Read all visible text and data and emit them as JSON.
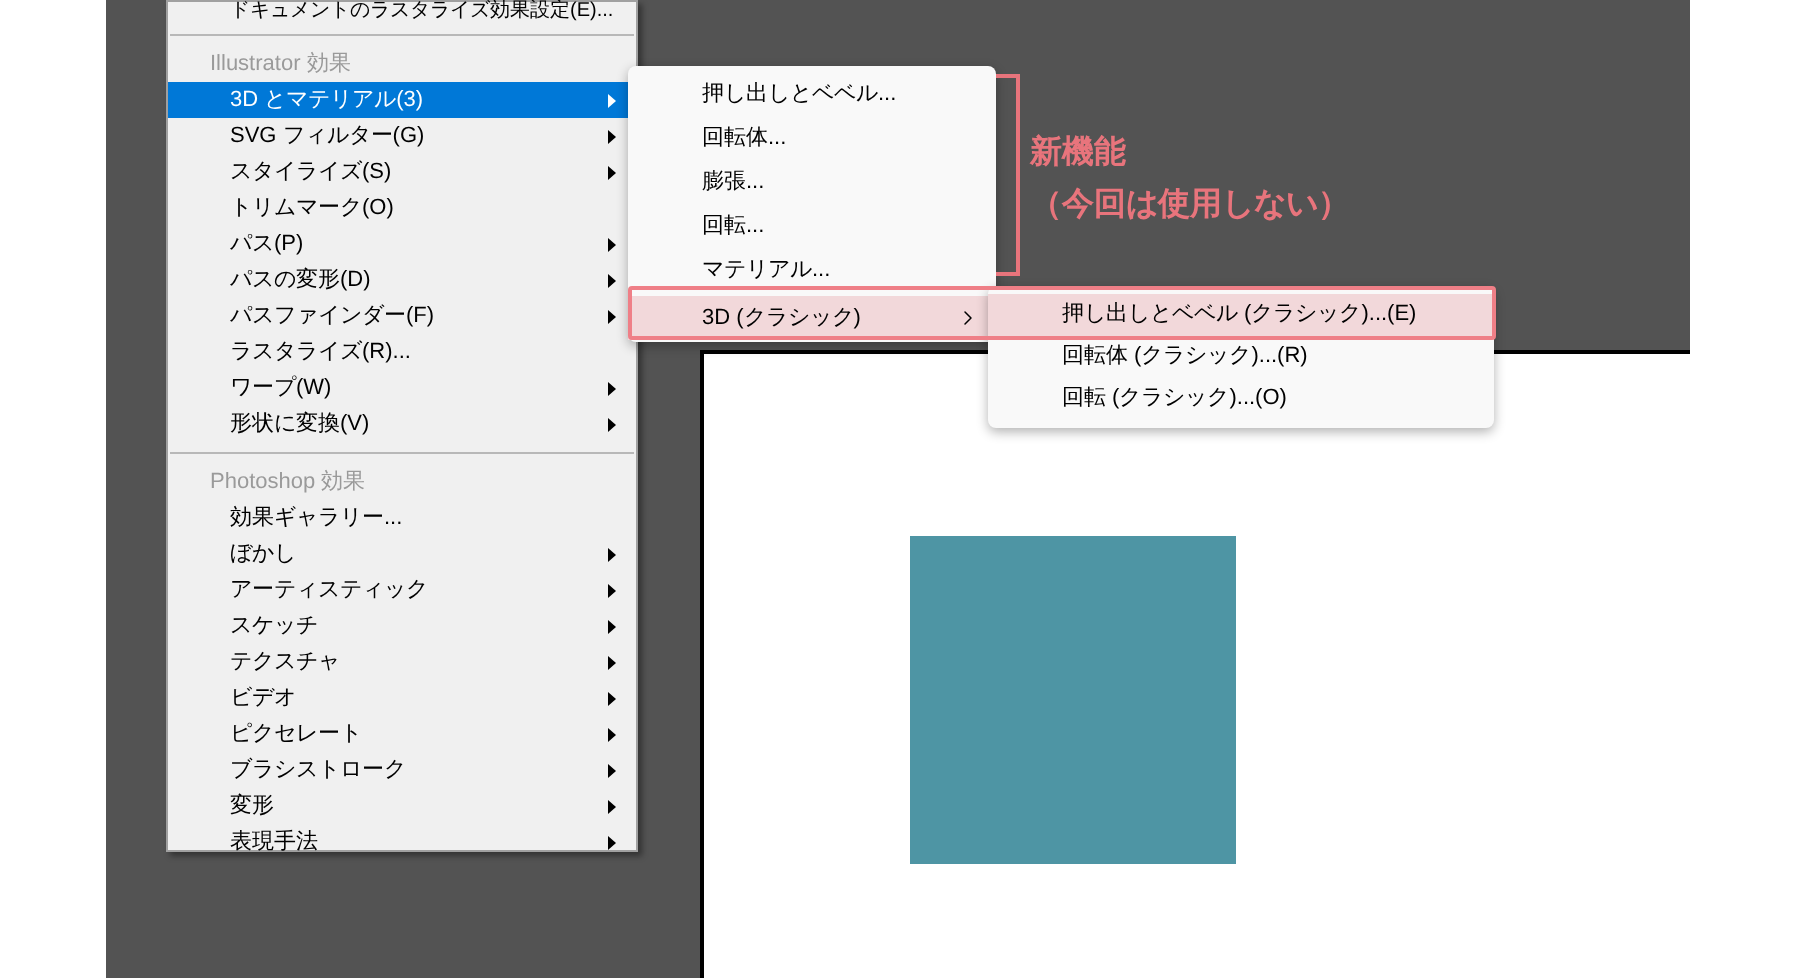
{
  "top_item": {
    "label": "ドキュメントのラスタライズ効果設定(E)..."
  },
  "illustrator_section": {
    "header": "Illustrator 効果",
    "items": [
      {
        "label": "3D とマテリアル(3)",
        "has_submenu": true,
        "selected": true
      },
      {
        "label": "SVG フィルター(G)",
        "has_submenu": true,
        "selected": false
      },
      {
        "label": "スタイライズ(S)",
        "has_submenu": true,
        "selected": false
      },
      {
        "label": "トリムマーク(O)",
        "has_submenu": false,
        "selected": false
      },
      {
        "label": "パス(P)",
        "has_submenu": true,
        "selected": false
      },
      {
        "label": "パスの変形(D)",
        "has_submenu": true,
        "selected": false
      },
      {
        "label": "パスファインダー(F)",
        "has_submenu": true,
        "selected": false
      },
      {
        "label": "ラスタライズ(R)...",
        "has_submenu": false,
        "selected": false
      },
      {
        "label": "ワープ(W)",
        "has_submenu": true,
        "selected": false
      },
      {
        "label": "形状に変換(V)",
        "has_submenu": true,
        "selected": false
      }
    ]
  },
  "photoshop_section": {
    "header": "Photoshop 効果",
    "items": [
      {
        "label": "効果ギャラリー...",
        "has_submenu": false,
        "selected": false
      },
      {
        "label": "ぼかし",
        "has_submenu": true,
        "selected": false
      },
      {
        "label": "アーティスティック",
        "has_submenu": true,
        "selected": false
      },
      {
        "label": "スケッチ",
        "has_submenu": true,
        "selected": false
      },
      {
        "label": "テクスチャ",
        "has_submenu": true,
        "selected": false
      },
      {
        "label": "ビデオ",
        "has_submenu": true,
        "selected": false
      },
      {
        "label": "ピクセレート",
        "has_submenu": true,
        "selected": false
      },
      {
        "label": "ブラシストローク",
        "has_submenu": true,
        "selected": false
      },
      {
        "label": "変形",
        "has_submenu": true,
        "selected": false
      },
      {
        "label": "表現手法",
        "has_submenu": true,
        "selected": false
      }
    ]
  },
  "submenu_3d": {
    "items": [
      {
        "label": "押し出しとベベル...",
        "has_submenu": false,
        "selected": false
      },
      {
        "label": "回転体...",
        "has_submenu": false,
        "selected": false
      },
      {
        "label": "膨張...",
        "has_submenu": false,
        "selected": false
      },
      {
        "label": "回転...",
        "has_submenu": false,
        "selected": false
      },
      {
        "label": "マテリアル...",
        "has_submenu": false,
        "selected": false
      },
      {
        "label": "3D (クラシック)",
        "has_submenu": true,
        "selected": true
      }
    ]
  },
  "submenu_classic": {
    "items": [
      {
        "label": "押し出しとベベル (クラシック)...(E)",
        "selected": true
      },
      {
        "label": "回転体 (クラシック)...(R)",
        "selected": false
      },
      {
        "label": "回転 (クラシック)...(O)",
        "selected": false
      }
    ]
  },
  "annotation": {
    "title": "新機能",
    "note": "（今回は使用しない）"
  }
}
